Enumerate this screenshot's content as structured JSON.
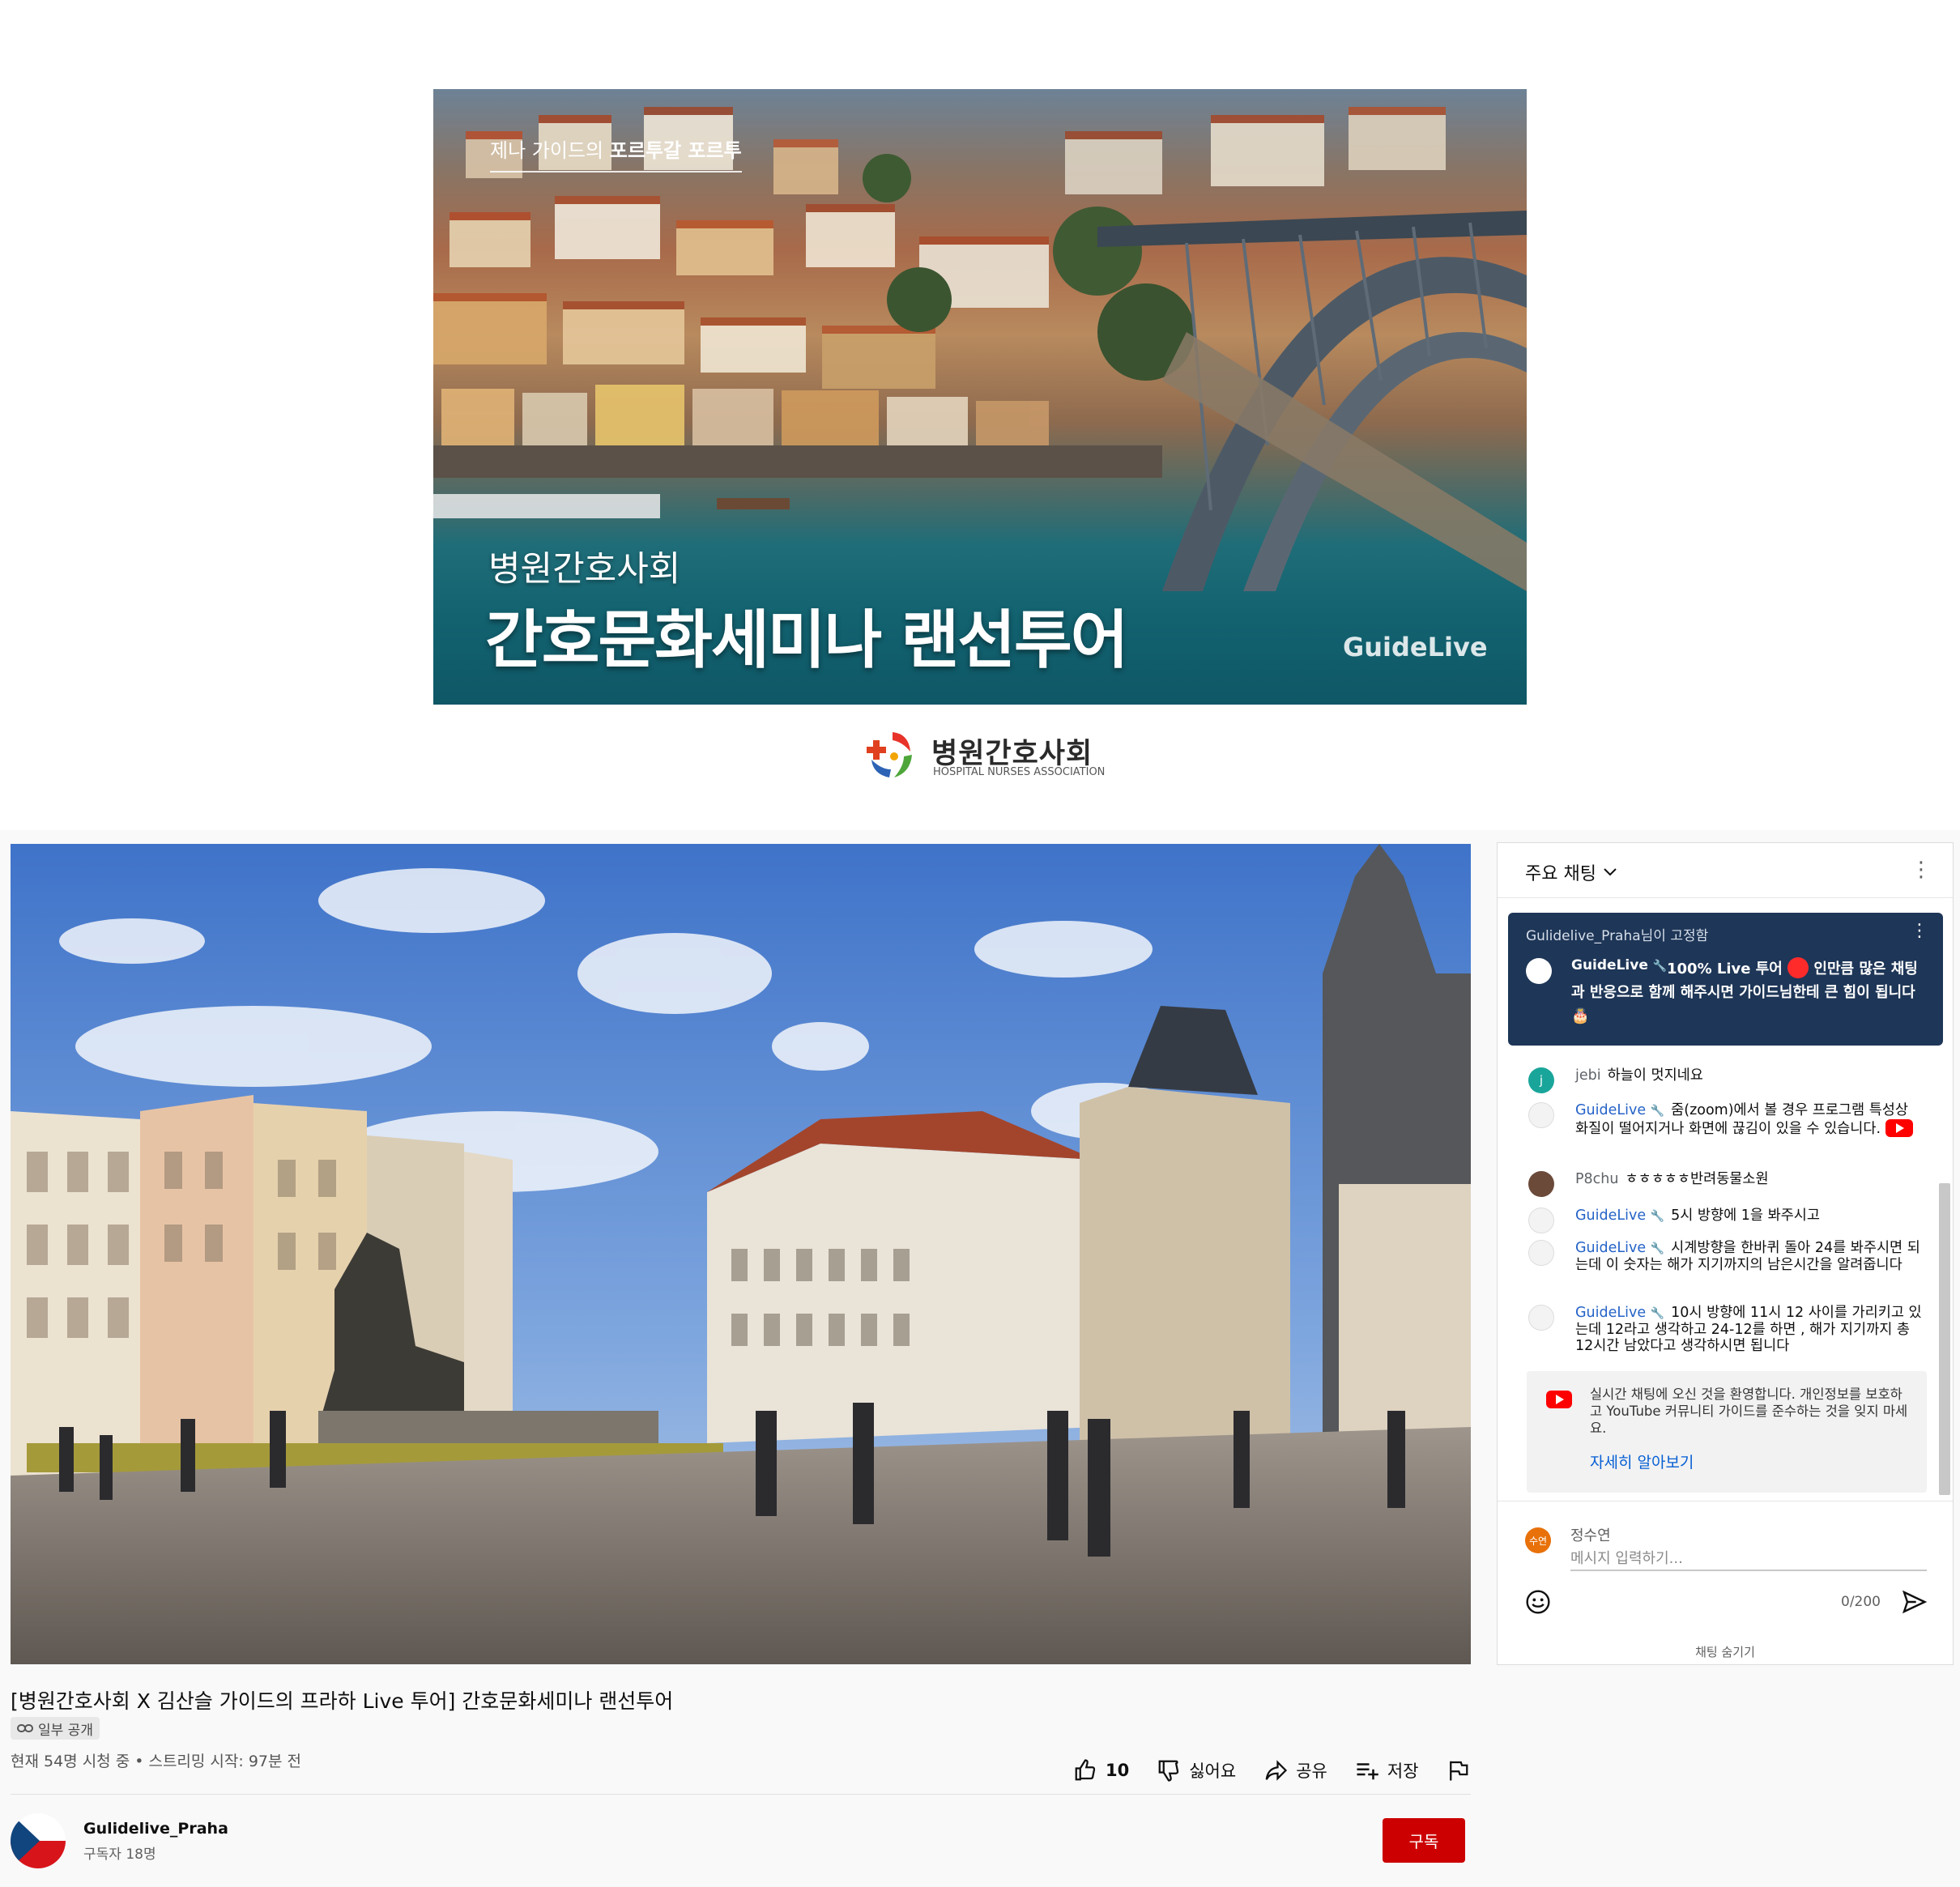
{
  "banner": {
    "top_text_plain": "제나 가이드의 ",
    "top_text_bold": "포르투갈 포르투",
    "subtitle": "병원간호사회",
    "title": "간호문화세미나 랜선투어",
    "watermark": "GuideLive"
  },
  "association": {
    "name": "병원간호사회",
    "name_en": "HOSPITAL NURSES ASSOCIATION"
  },
  "video": {
    "title": "[병원간호사회 X 김산슬 가이드의 프라하 Live 투어] 간호문화세미나 랜선투어",
    "visibility": "일부 공개",
    "stats": "현재 54명 시청 중 • 스트리밍 시작: 97분 전"
  },
  "actions": {
    "like_count": "10",
    "dislike_label": "싫어요",
    "share_label": "공유",
    "save_label": "저장"
  },
  "channel": {
    "name": "Gulidelive_Praha",
    "subscribers": "구독자 18명",
    "subscribe_label": "구독"
  },
  "chat": {
    "mode_label": "주요 채팅",
    "pinned": {
      "pinned_by": "Gulidelive_Praha님이 고정함",
      "author": "GuideLive",
      "text_a": "100% Live 투어",
      "text_b": " 인만큼 많은 채팅과 반응으로 함께 해주시면 가이드님한테 큰 힘이 됩니다 🎂"
    },
    "messages": [
      {
        "author": "jebi",
        "text": "하늘이 멋지네요",
        "owner": false,
        "avatar": "j",
        "avatar_color": "#1aa59a"
      },
      {
        "author": "GuideLive",
        "text": "줌(zoom)에서 볼 경우 프로그램 특성상 화질이 떨어지거나 화면에 끊김이 있을 수 있습니다.",
        "owner": true,
        "badge": true
      },
      {
        "author": "P8chu",
        "text": "ㅎㅎㅎㅎㅎ반려동물소원",
        "owner": false,
        "avatar_color": "#6b4a3a"
      },
      {
        "author": "GuideLive",
        "text": "5시 방향에 1을 봐주시고",
        "owner": true
      },
      {
        "author": "GuideLive",
        "text": "시계방향을 한바퀴 돌아 24를 봐주시면 되는데 이 숫자는 해가 지기까지의 남은시간을 알려줍니다",
        "owner": true
      },
      {
        "author": "GuideLive",
        "text": "10시 방향에 11시 12 사이를 가리키고 있는데 12라고 생각하고 24-12를 하면 , 해가 지기까지 총 12시간 남았다고 생각하시면 됩니다",
        "owner": true
      }
    ],
    "welcome_text": "실시간 채팅에 오신 것을 환영합니다. 개인정보를 보호하고 YouTube 커뮤니티 가이드를 준수하는 것을 잊지 마세요.",
    "welcome_link": "자세히 알아보기",
    "me_name": "정수연",
    "me_avatar": "수연",
    "input_placeholder": "메시지 입력하기...",
    "char_count": "0/200",
    "hide_label": "채팅 숨기기"
  },
  "colors": {
    "subscribe_red": "#cc0000",
    "owner_blue": "#2563c7",
    "pinned_bg": "#1e3657",
    "link_blue": "#065fd4"
  }
}
